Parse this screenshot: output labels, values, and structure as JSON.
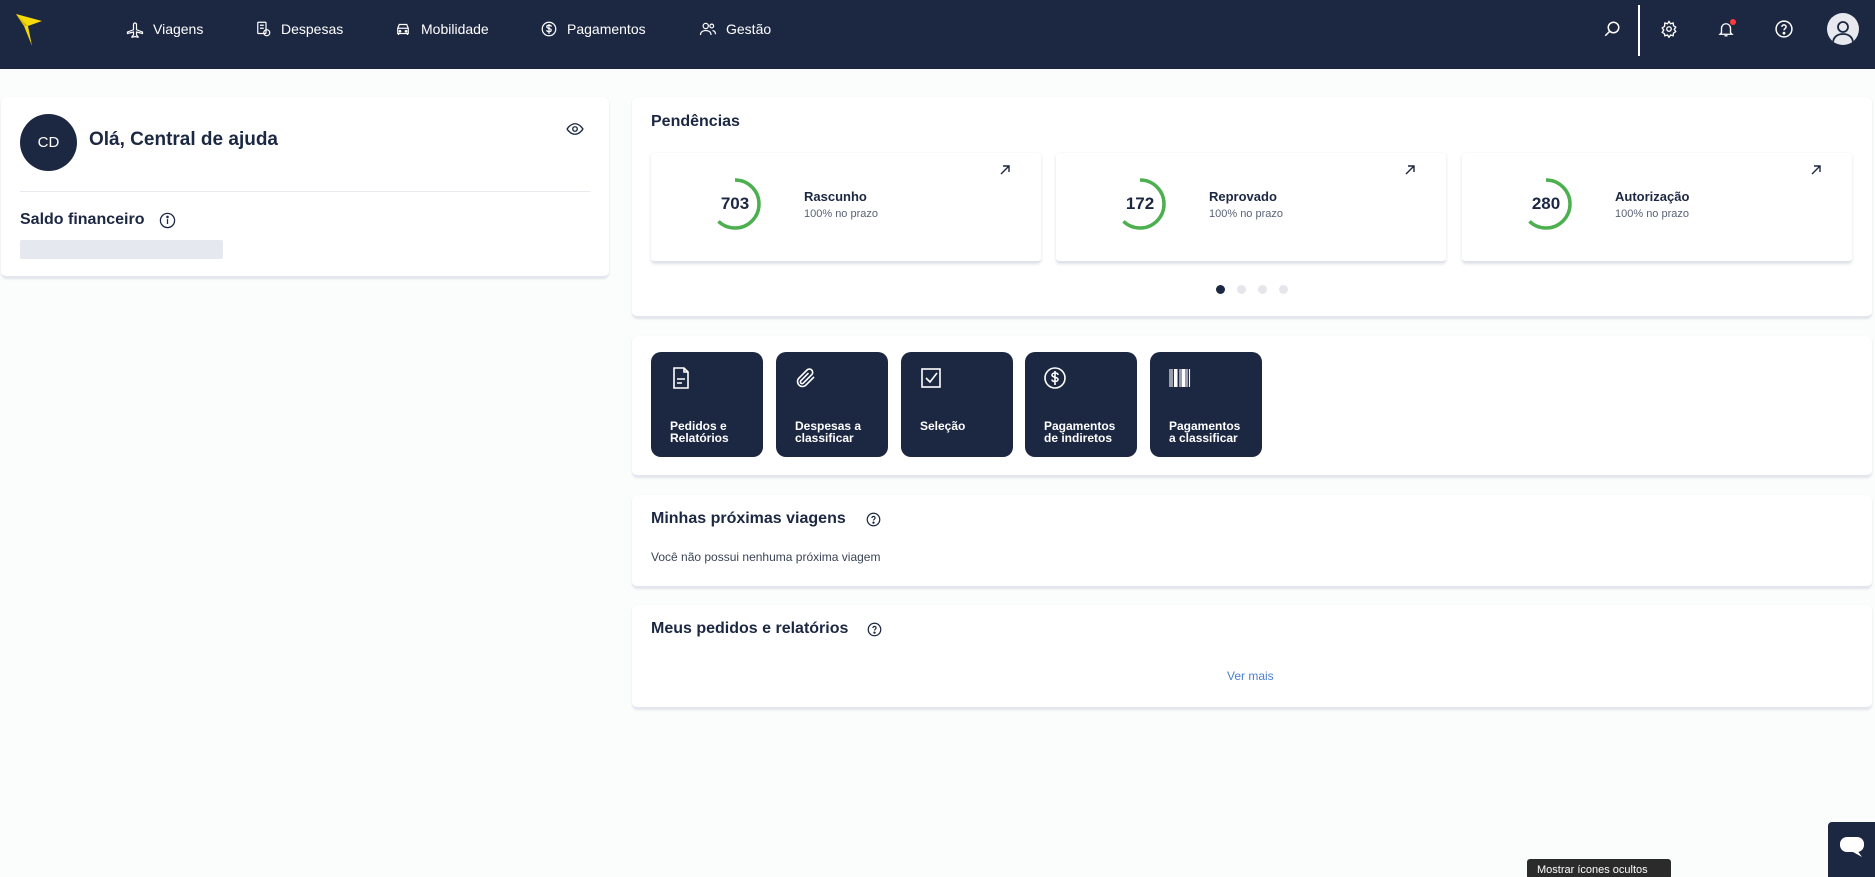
{
  "nav": {
    "items": [
      {
        "label": "Viagens",
        "icon": "airplane-icon"
      },
      {
        "label": "Despesas",
        "icon": "receipt-icon"
      },
      {
        "label": "Mobilidade",
        "icon": "car-icon"
      },
      {
        "label": "Pagamentos",
        "icon": "dollar-icon"
      },
      {
        "label": "Gestão",
        "icon": "users-icon"
      }
    ],
    "right_icons": [
      "search-icon",
      "gear-icon",
      "bell-icon",
      "help-icon",
      "user-avatar-icon"
    ]
  },
  "profile": {
    "initials": "CD",
    "greeting": "Olá, Central de ajuda",
    "balance_label": "Saldo financeiro"
  },
  "pending": {
    "title": "Pendências",
    "items": [
      {
        "count": "703",
        "label": "Rascunho",
        "subtitle": "100% no prazo",
        "progress": 0.62
      },
      {
        "count": "172",
        "label": "Reprovado",
        "subtitle": "100% no prazo",
        "progress": 0.62
      },
      {
        "count": "280",
        "label": "Autorização",
        "subtitle": "100% no prazo",
        "progress": 0.62
      }
    ],
    "pages": 4,
    "active_page": 1
  },
  "shortcuts": [
    {
      "line1": "Pedidos e",
      "line2": "Relatórios",
      "icon": "document-icon"
    },
    {
      "line1": "Despesas a",
      "line2": "classificar",
      "icon": "paperclip-icon"
    },
    {
      "line1": "Seleção",
      "line2": "",
      "icon": "checkbox-icon"
    },
    {
      "line1": "Pagamentos",
      "line2": "de indiretos",
      "icon": "dollar-circle-icon"
    },
    {
      "line1": "Pagamentos",
      "line2": "a classificar",
      "icon": "barcode-icon"
    }
  ],
  "trips": {
    "title": "Minhas próximas viagens",
    "empty_text": "Você não possui nenhuma próxima viagem"
  },
  "orders": {
    "title": "Meus pedidos e relatórios",
    "see_more": "Ver mais"
  },
  "tooltip": {
    "text": "Mostrar ícones ocultos"
  },
  "colors": {
    "navy": "#1c2742",
    "accent_yellow": "#f5d90a",
    "ring_green": "#4caf50",
    "link_blue": "#4a7fd4",
    "notification_red": "#ff3b3b"
  }
}
